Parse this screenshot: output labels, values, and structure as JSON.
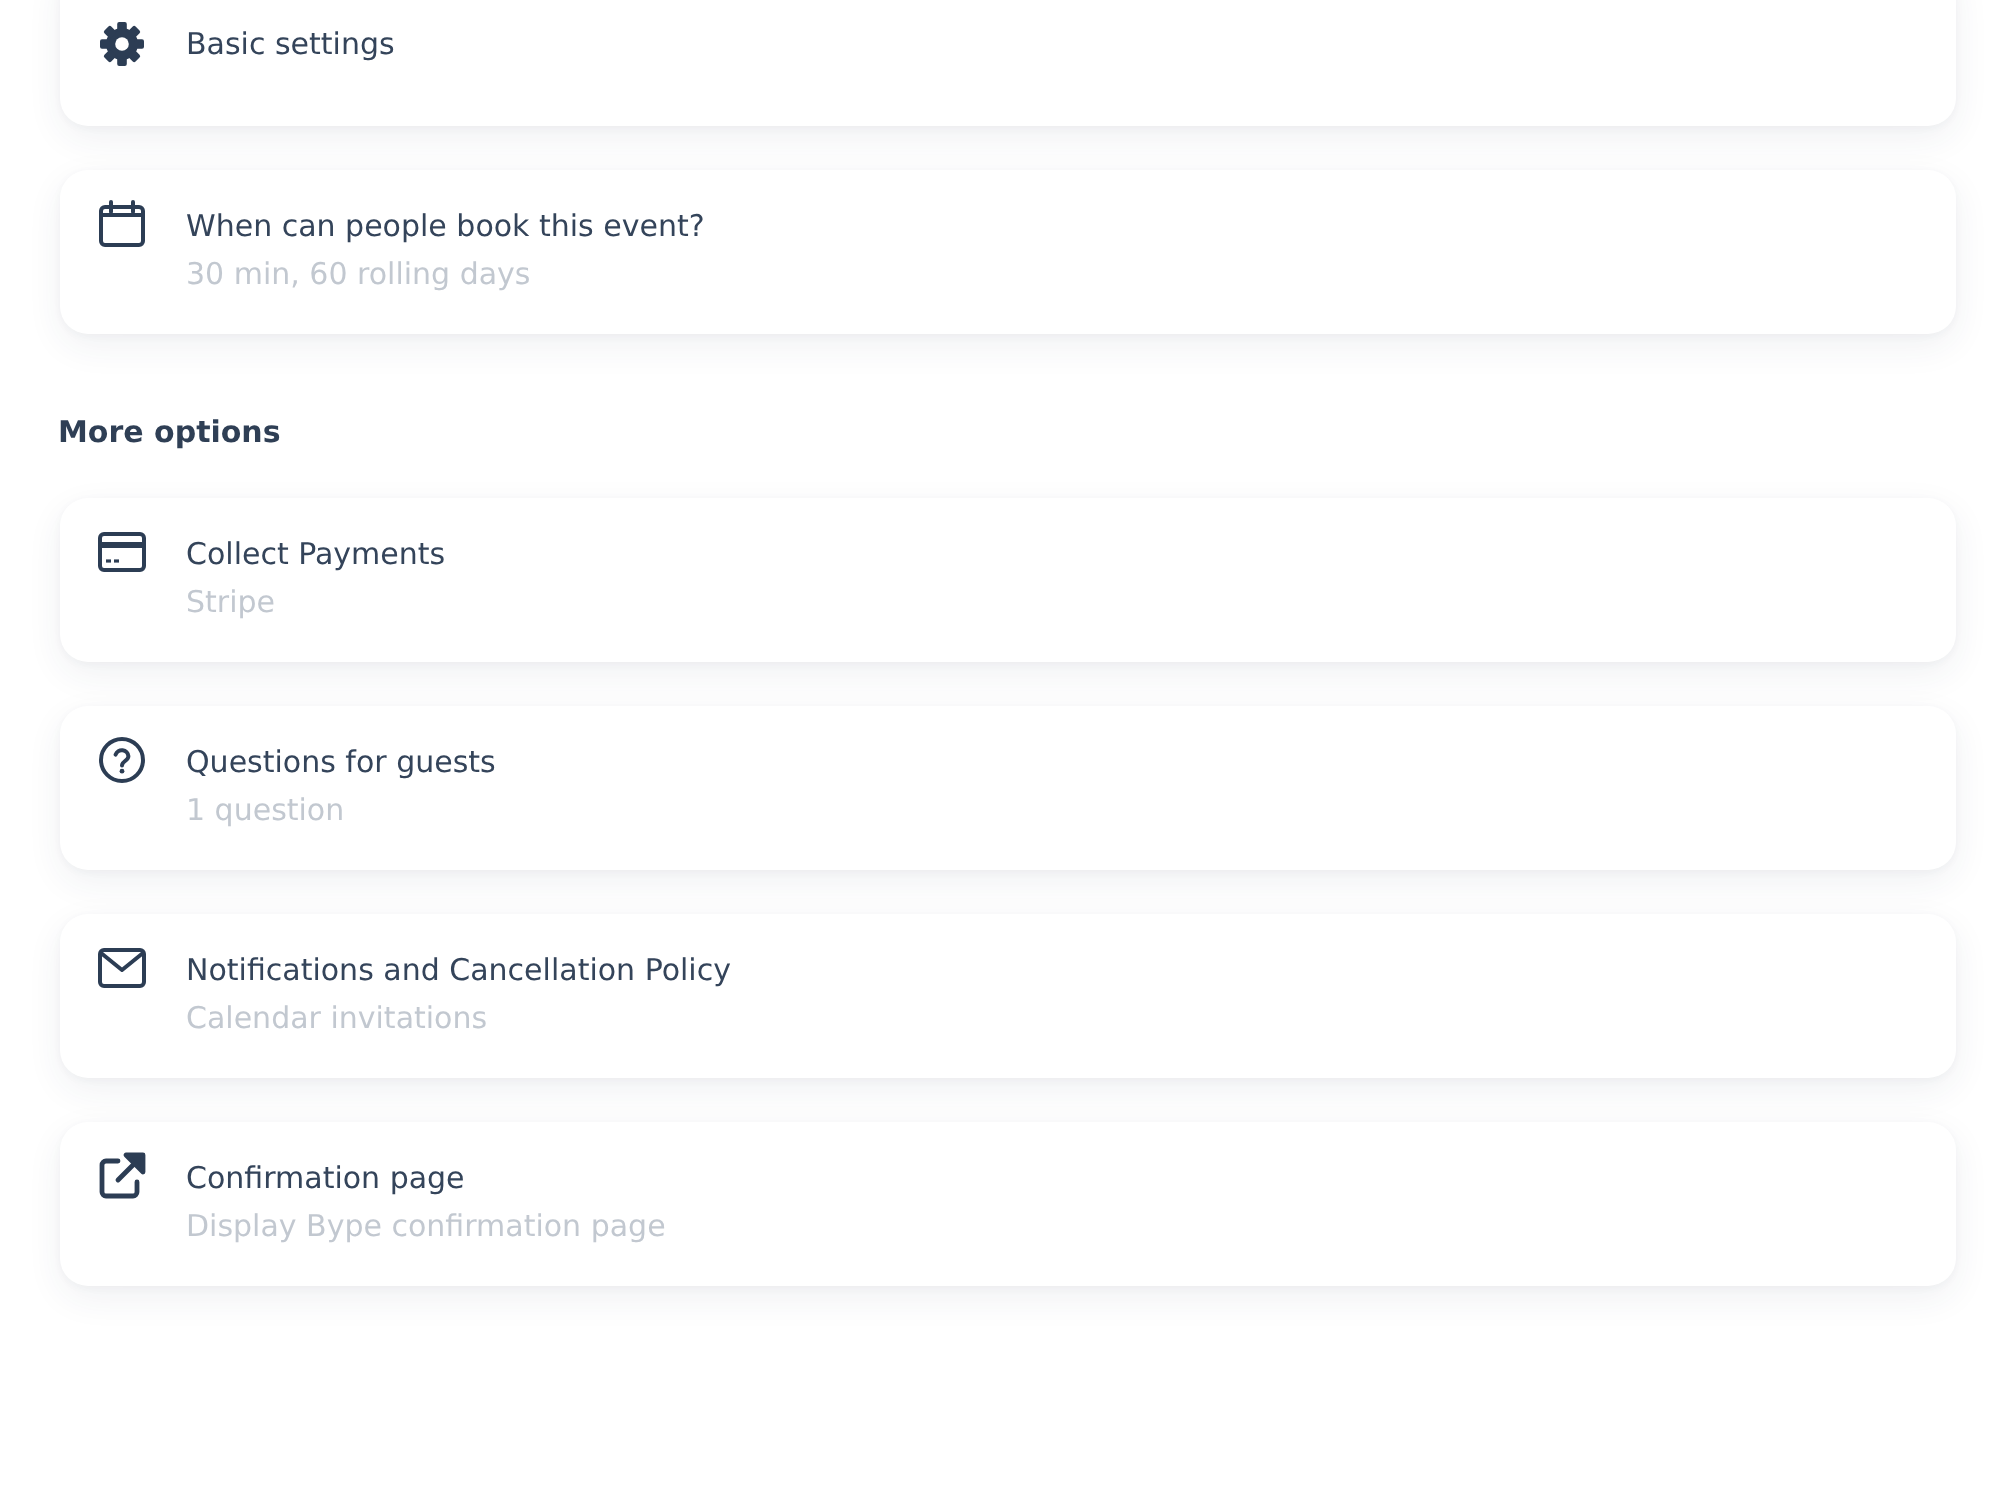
{
  "top_cards": [
    {
      "kind": "gear",
      "title": "Basic settings"
    },
    {
      "kind": "calendar",
      "title": "When can people book this event?",
      "subtitle": "30 min, 60 rolling days"
    }
  ],
  "more_options": {
    "heading": "More options",
    "cards": [
      {
        "kind": "card",
        "title": "Collect Payments",
        "subtitle": "Stripe"
      },
      {
        "kind": "question",
        "title": "Questions for guests",
        "subtitle": "1 question"
      },
      {
        "kind": "envelope",
        "title": "Notifications and Cancellation Policy",
        "subtitle": "Calendar invitations"
      },
      {
        "kind": "external",
        "title": "Confirmation page",
        "subtitle": "Display Bype confirmation page"
      }
    ]
  }
}
